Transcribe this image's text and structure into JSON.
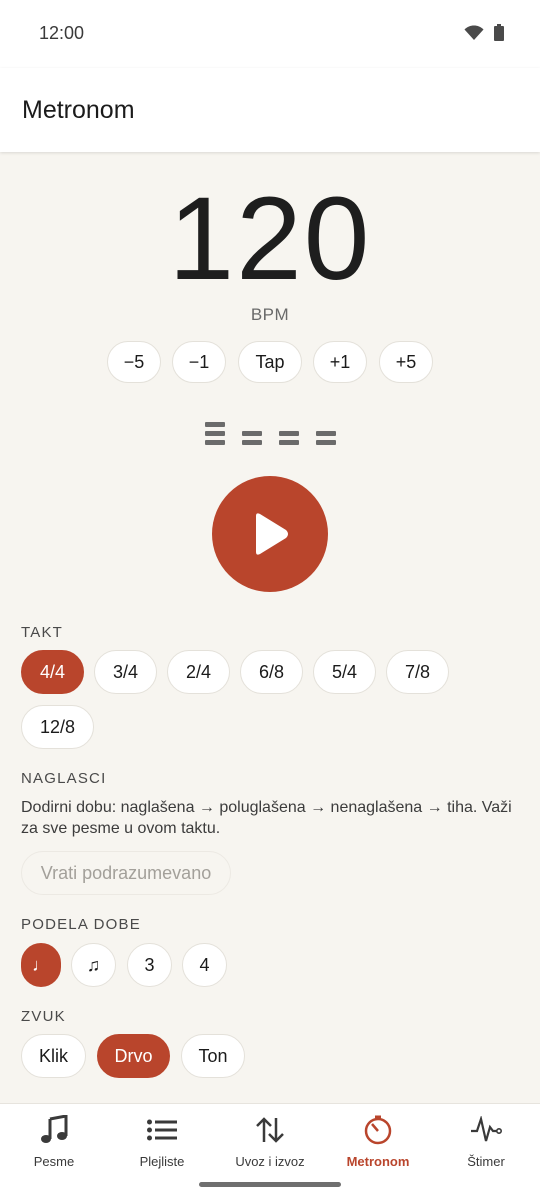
{
  "status_bar": {
    "time": "12:00"
  },
  "app_bar": {
    "title": "Metronom"
  },
  "bpm": {
    "value": "120",
    "unit": "BPM"
  },
  "tempo_buttons": [
    "−5",
    "−1",
    "Tap",
    "+1",
    "+5"
  ],
  "beats_count": 4,
  "takt": {
    "label": "TAKT",
    "options": [
      "4/4",
      "3/4",
      "2/4",
      "6/8",
      "5/4",
      "7/8",
      "12/8"
    ],
    "selected": "4/4"
  },
  "naglasci": {
    "label": "NAGLASCI",
    "hint": "Dodirni dobu: naglašena → poluglašena → nenaglašena → tiha. Važi za sve pesme u ovom taktu.",
    "reset_label": "Vrati podrazumevano"
  },
  "podela_dobe": {
    "label": "PODELA DOBE",
    "options": [
      "♩",
      "♫",
      "3",
      "4"
    ],
    "selected": "♩"
  },
  "zvuk": {
    "label": "ZVUK",
    "options": [
      "Klik",
      "Drvo",
      "Ton"
    ],
    "selected": "Drvo"
  },
  "nav": {
    "items": [
      "Pesme",
      "Plejliste",
      "Uvoz i izvoz",
      "Metronom",
      "Štimer"
    ],
    "active": "Metronom"
  },
  "colors": {
    "accent": "#b9452c",
    "background": "#f7f5f0"
  }
}
